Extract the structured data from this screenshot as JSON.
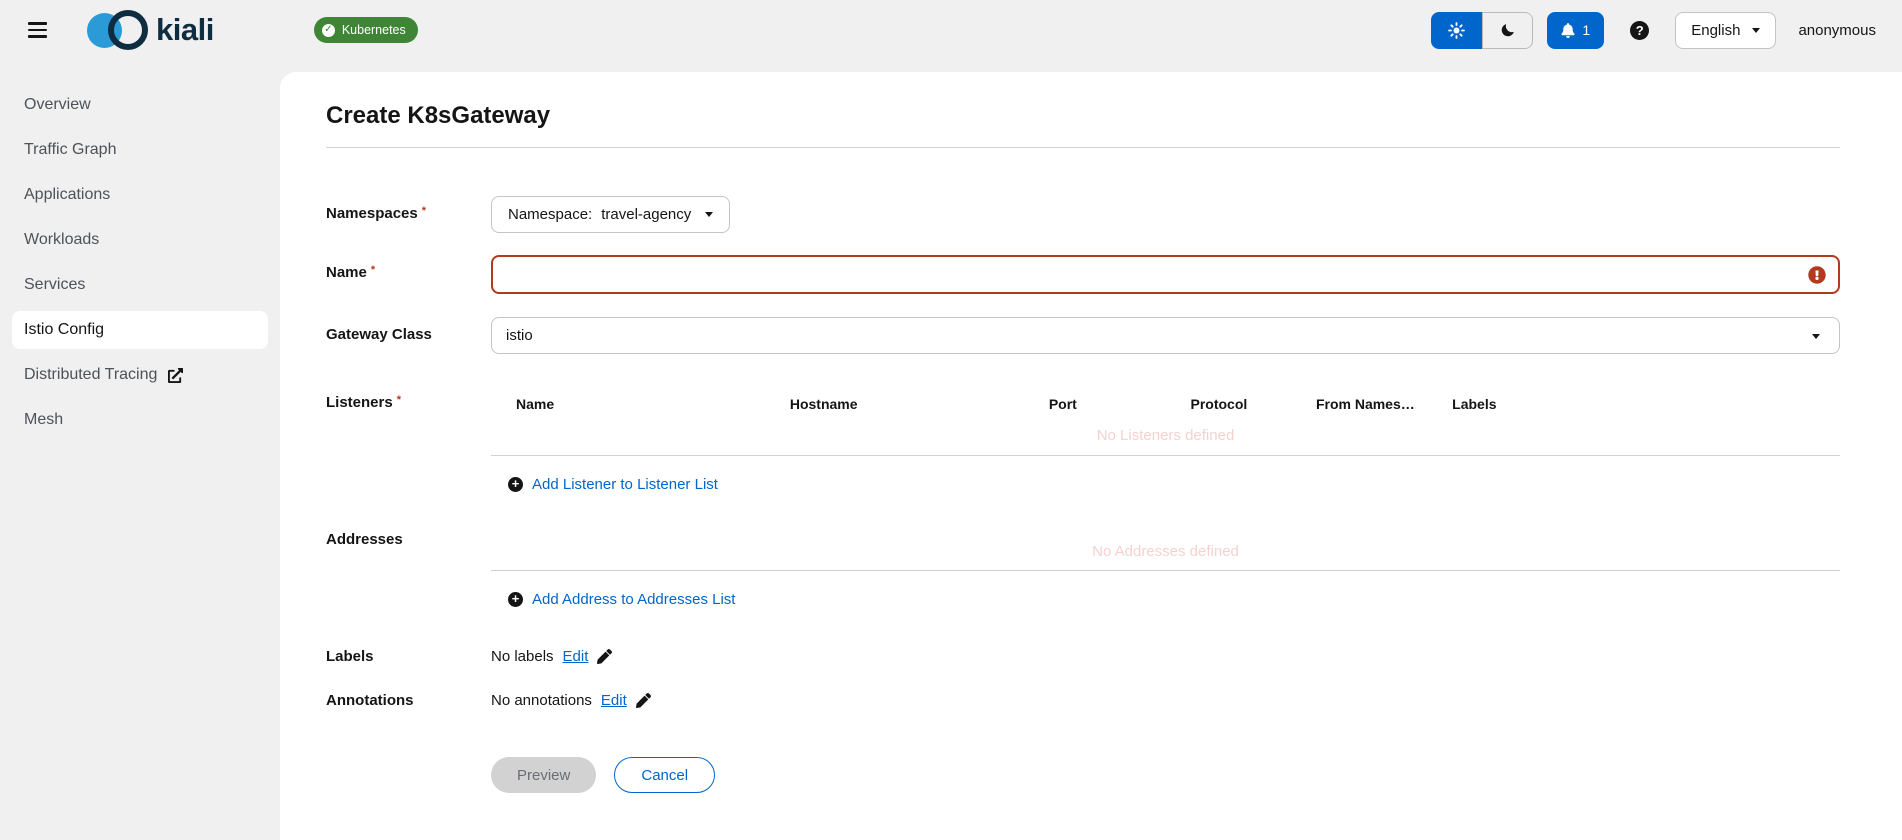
{
  "masthead": {
    "brand": "kiali",
    "badge_label": "Kubernetes",
    "notification_count": "1",
    "language": "English",
    "user": "anonymous"
  },
  "sidebar": {
    "items": [
      {
        "label": "Overview"
      },
      {
        "label": "Traffic Graph"
      },
      {
        "label": "Applications"
      },
      {
        "label": "Workloads"
      },
      {
        "label": "Services"
      },
      {
        "label": "Istio Config"
      },
      {
        "label": "Distributed Tracing"
      },
      {
        "label": "Mesh"
      }
    ]
  },
  "page": {
    "title": "Create K8sGateway"
  },
  "ui": {
    "required_marker": "*"
  },
  "form": {
    "namespaces": {
      "label": "Namespaces",
      "dropdown_prefix": "Namespace:",
      "selected": "travel-agency"
    },
    "name": {
      "label": "Name",
      "value": ""
    },
    "gateway_class": {
      "label": "Gateway Class",
      "selected": "istio"
    },
    "listeners": {
      "label": "Listeners",
      "columns": [
        "Name",
        "Hostname",
        "Port",
        "Protocol",
        "From Namespac...",
        "Labels"
      ],
      "empty_text": "No Listeners defined",
      "add_label": "Add Listener to Listener List"
    },
    "addresses": {
      "label": "Addresses",
      "empty_text": "No Addresses defined",
      "add_label": "Add Address to Addresses List"
    },
    "labels": {
      "label": "Labels",
      "value_text": "No labels",
      "edit_label": "Edit"
    },
    "annotations": {
      "label": "Annotations",
      "value_text": "No annotations",
      "edit_label": "Edit"
    },
    "actions": {
      "preview": "Preview",
      "cancel": "Cancel"
    }
  },
  "icons": {
    "check_glyph": "✓",
    "help_glyph": "?",
    "plus_glyph": "+"
  },
  "colors": {
    "primary_blue": "#0066cc",
    "badge_green": "#3e8635",
    "danger": "#b13a1f",
    "empty_pink": "#f5d2cf",
    "page_bg": "#f0f0f0",
    "brand_navy": "#0f2d40",
    "brand_blue": "#2b9bd7"
  }
}
